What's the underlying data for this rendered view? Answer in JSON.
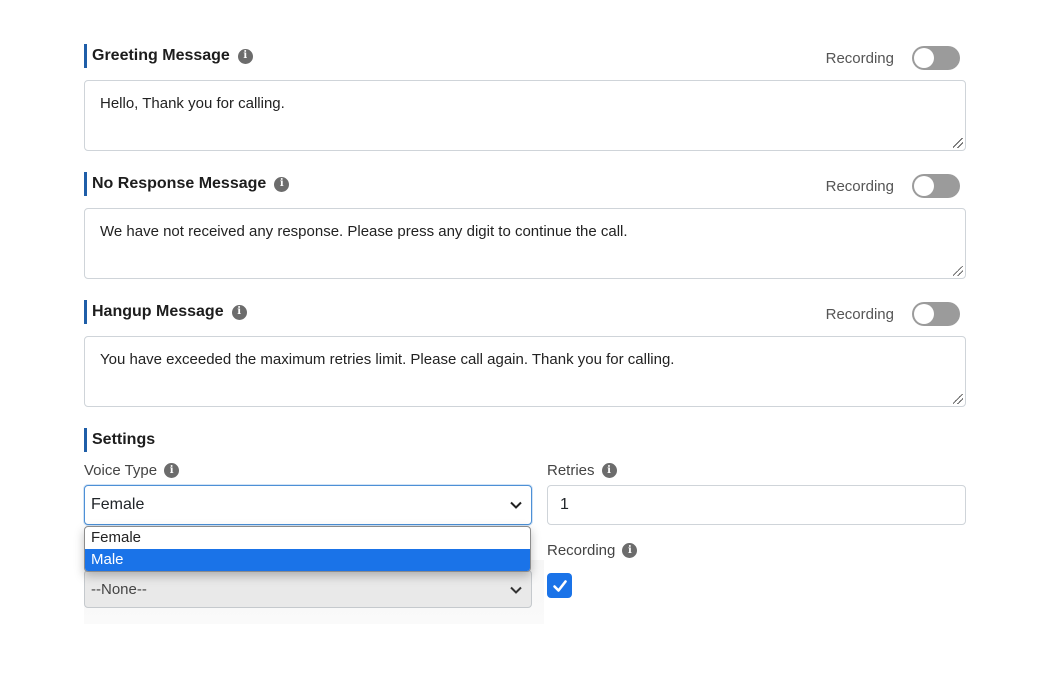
{
  "greeting": {
    "title": "Greeting Message",
    "recording_label": "Recording",
    "recording_on": false,
    "message": "Hello, Thank you for calling."
  },
  "no_response": {
    "title": "No Response Message",
    "recording_label": "Recording",
    "recording_on": false,
    "message": "We have not received any response. Please press any digit to continue the call."
  },
  "hangup": {
    "title": "Hangup Message",
    "recording_label": "Recording",
    "recording_on": false,
    "message": "You have exceeded the maximum retries limit. Please call again. Thank you for calling."
  },
  "settings": {
    "title": "Settings",
    "voice_type_label": "Voice Type",
    "voice_type_value": "Female",
    "voice_type_options": [
      "Female",
      "Male"
    ],
    "voice_type_highlighted": "Male",
    "hidden_select_value": "--None--",
    "retries_label": "Retries",
    "retries_value": "1",
    "recording_label": "Recording",
    "recording_checked": true
  },
  "colors": {
    "accent": "#1a73e8",
    "section_bar": "#1f5ea8",
    "toggle_off": "#9b9b9b"
  }
}
